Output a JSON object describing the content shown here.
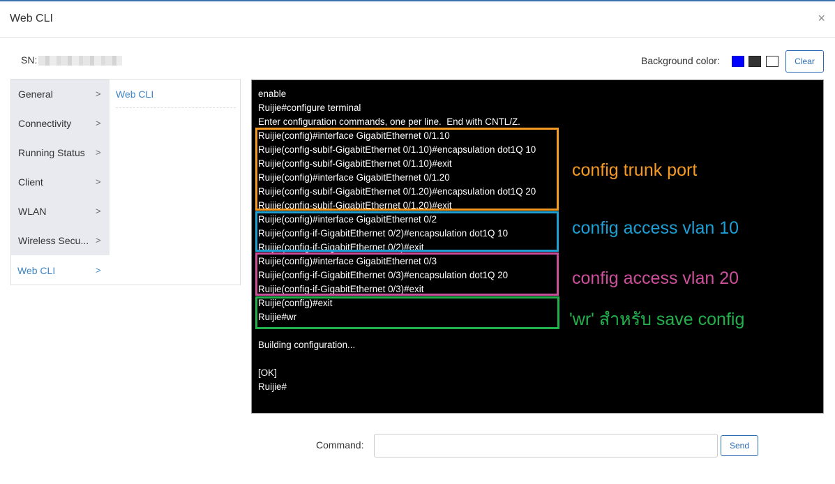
{
  "window": {
    "title": "Web CLI",
    "close_glyph": "×"
  },
  "sn": {
    "label": "SN:"
  },
  "toolbar": {
    "background_label": "Background color:",
    "swatches": [
      "#0000ff",
      "#333333",
      "#ffffff"
    ],
    "clear_label": "Clear"
  },
  "sidebar": {
    "items": [
      {
        "label": "General",
        "chevron": ">"
      },
      {
        "label": "Connectivity",
        "chevron": ">"
      },
      {
        "label": "Running Status",
        "chevron": ">"
      },
      {
        "label": "Client",
        "chevron": ">"
      },
      {
        "label": "WLAN",
        "chevron": ">"
      },
      {
        "label": "Wireless Secu...",
        "chevron": ">"
      },
      {
        "label": "Web CLI",
        "chevron": ">",
        "active": true
      }
    ],
    "subitem": "Web CLI"
  },
  "terminal": {
    "background": "#000000",
    "lines": [
      "enable",
      "Ruijie#configure terminal",
      "Enter configuration commands, one per line.  End with CNTL/Z.",
      "Ruijie(config)#interface GigabitEthernet 0/1.10",
      "Ruijie(config-subif-GigabitEthernet 0/1.10)#encapsulation dot1Q 10",
      "Ruijie(config-subif-GigabitEthernet 0/1.10)#exit",
      "Ruijie(config)#interface GigabitEthernet 0/1.20",
      "Ruijie(config-subif-GigabitEthernet 0/1.20)#encapsulation dot1Q 20",
      "Ruijie(config-subif-GigabitEthernet 0/1.20)#exit",
      "Ruijie(config)#interface GigabitEthernet 0/2",
      "Ruijie(config-if-GigabitEthernet 0/2)#encapsulation dot1Q 10",
      "Ruijie(config-if-GigabitEthernet 0/2)#exit",
      "Ruijie(config)#interface GigabitEthernet 0/3",
      "Ruijie(config-if-GigabitEthernet 0/3)#encapsulation dot1Q 20",
      "Ruijie(config-if-GigabitEthernet 0/3)#exit",
      "Ruijie(config)#exit",
      "Ruijie#wr",
      "",
      "Building configuration...",
      "",
      "[OK]",
      "Ruijie#"
    ]
  },
  "annotations": {
    "trunk": {
      "text": "config trunk port",
      "color": "#f59a23"
    },
    "access10": {
      "text": "config access vlan 10",
      "color": "#1e9fd4"
    },
    "access20": {
      "text": "config access vlan 20",
      "color": "#cc4f9c"
    },
    "save": {
      "text": "'wr' สำหรับ save config",
      "color": "#22b14c"
    }
  },
  "command": {
    "label": "Command:",
    "value": "",
    "placeholder": "",
    "send_label": "Send"
  }
}
